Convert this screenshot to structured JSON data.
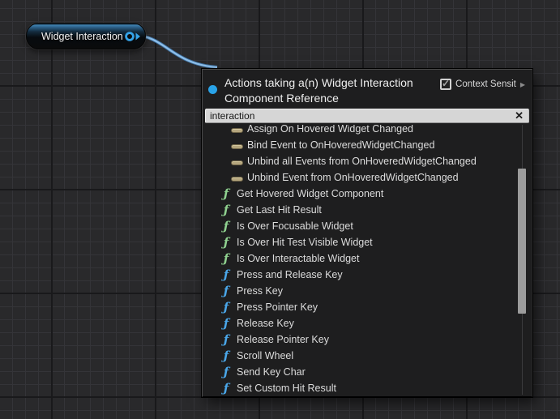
{
  "graph": {
    "node": {
      "title": "Widget Interaction"
    }
  },
  "menu": {
    "title": "Actions taking a(n) Widget Interaction Component Reference",
    "context_sensitive": {
      "label": "Context Sensit",
      "checked": true,
      "check_glyph": "✓",
      "expand_glyph": "▶"
    },
    "search": {
      "value": "interaction",
      "clear_glyph": "✕"
    },
    "items": [
      {
        "icon": "delegate",
        "label": "Assign On Hovered Widget Changed"
      },
      {
        "icon": "delegate",
        "label": "Bind Event to OnHoveredWidgetChanged"
      },
      {
        "icon": "delegate",
        "label": "Unbind all Events from OnHoveredWidgetChanged"
      },
      {
        "icon": "delegate",
        "label": "Unbind Event from OnHoveredWidgetChanged"
      },
      {
        "icon": "function-pure",
        "label": "Get Hovered Widget Component"
      },
      {
        "icon": "function-pure",
        "label": "Get Last Hit Result"
      },
      {
        "icon": "function-pure",
        "label": "Is Over Focusable Widget"
      },
      {
        "icon": "function-pure",
        "label": "Is Over Hit Test Visible Widget"
      },
      {
        "icon": "function-pure",
        "label": "Is Over Interactable Widget"
      },
      {
        "icon": "function",
        "label": "Press and Release Key"
      },
      {
        "icon": "function",
        "label": "Press Key"
      },
      {
        "icon": "function",
        "label": "Press Pointer Key"
      },
      {
        "icon": "function",
        "label": "Release Key"
      },
      {
        "icon": "function",
        "label": "Release Pointer Key"
      },
      {
        "icon": "function",
        "label": "Scroll Wheel"
      },
      {
        "icon": "function",
        "label": "Send Key Char"
      },
      {
        "icon": "function",
        "label": "Set Custom Hit Result"
      }
    ]
  },
  "icons": {
    "function_glyph": "ƒ"
  },
  "colors": {
    "wire": "#8ebfea",
    "pin": "#35a3e8",
    "bullet": "#29a3e8",
    "function_pure": "#8fd18f",
    "function_impure": "#4aa6e8",
    "delegate": "#b5a67e"
  }
}
